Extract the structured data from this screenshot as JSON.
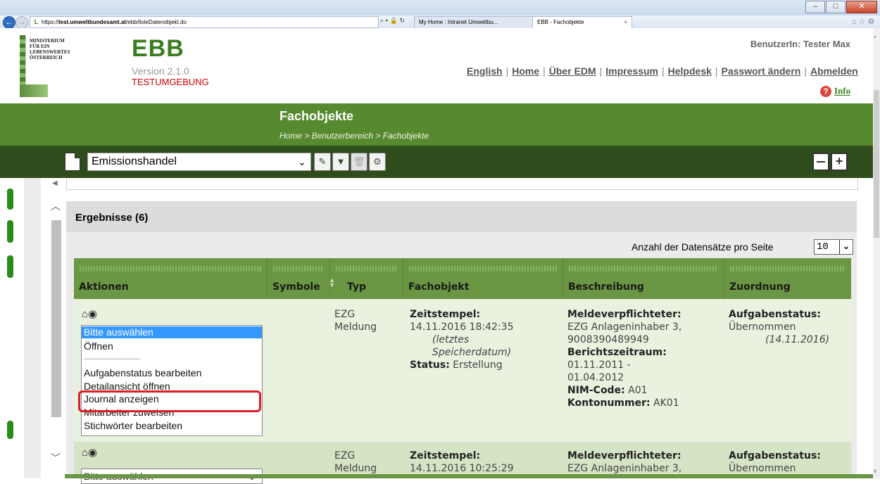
{
  "browser": {
    "address_host": "test.umweltbundesamt.at",
    "address_path": "/ebb/listeDatenobjekt.do",
    "tabs": [
      {
        "label": "My Home : Intranet Umweltbu..."
      },
      {
        "label": "EBB - Fachobjekte"
      }
    ]
  },
  "ministry": {
    "text": "MINISTERIUM\nFÜR EIN\nLEBENSWERTES\nÖSTERREICH"
  },
  "app": {
    "logo": "EBB",
    "version": "Version 2.1.0",
    "environment": "TESTUMGEBUNG"
  },
  "user": {
    "label": "BenutzerIn: Tester Max"
  },
  "top_links": {
    "english": "English",
    "home": "Home",
    "about": "Über EDM",
    "imprint": "Impressum",
    "helpdesk": "Helpdesk",
    "password": "Passwort ändern",
    "logout": "Abmelden"
  },
  "info": {
    "label": "Info"
  },
  "page": {
    "title": "Fachobjekte",
    "breadcrumb": "Home > Benutzerbereich > Fachobjekte"
  },
  "toolbar": {
    "category": "Emissionshandel"
  },
  "results": {
    "title": "Ergebnisse (6)",
    "per_page_label": "Anzahl der Datensätze pro Seite",
    "per_page_value": "10"
  },
  "table": {
    "headers": {
      "actions": "Aktionen",
      "symbols": "Symbole",
      "type": "Typ",
      "object": "Fachobjekt",
      "description": "Beschreibung",
      "assignment": "Zuordnung"
    },
    "rows": [
      {
        "type_line1": "EZG",
        "type_line2": "Meldung",
        "timestamp_label": "Zeitstempel:",
        "timestamp": "14.11.2016 18:42:35",
        "timestamp_note_1": "(letztes",
        "timestamp_note_2": "Speicherdatum)",
        "status_label": "Status:",
        "status": "Erstellung",
        "reporter_label": "Meldeverpflichteter:",
        "reporter_line1": "EZG Anlageninhaber 3,",
        "reporter_line2": "9008390489949",
        "period_label": "Berichtszeitraum:",
        "period_line1": "01.11.2011 -",
        "period_line2": "01.04.2012",
        "nim_label": "NIM-Code:",
        "nim": "A01",
        "account_label": "Kontonummer:",
        "account": "AK01",
        "task_label": "Aufgabenstatus:",
        "task": "Übernommen",
        "task_date": "(14.11.2016)"
      },
      {
        "type_line1": "EZG",
        "type_line2": "Meldung",
        "timestamp_label": "Zeitstempel:",
        "timestamp": "14.11.2016 10:25:29",
        "reporter_label": "Meldeverpflichteter:",
        "reporter_line1": "EZG Anlageninhaber 3,",
        "task_label": "Aufgabenstatus:",
        "task": "Übernommen"
      }
    ]
  },
  "action_menu": {
    "options": [
      "Bitte auswählen",
      "Öffnen",
      "----------------------------------",
      "Aufgabenstatus bearbeiten",
      "Detailansicht öffnen",
      "Journal anzeigen",
      "Mitarbeiter zuweisen",
      "Stichwörter bearbeiten"
    ],
    "selected_index": 0,
    "highlighted": "Journal anzeigen",
    "collapsed_value": "Bitte auswählen"
  },
  "icons": {
    "back": "back-arrow-icon",
    "forward": "forward-arrow-icon",
    "document": "document-icon",
    "edit": "edit-icon",
    "filter": "filter-icon",
    "delete": "trash-icon",
    "settings": "settings-icon",
    "collapse": "collapse-icon",
    "expand": "expand-icon",
    "info": "help-icon",
    "row_actions": "house-eye-icon"
  },
  "colors": {
    "brand_green": "#3a7d1e",
    "band_green": "#578a30",
    "toolbar_dark": "#2f4d1c",
    "table_head": "#6b9744",
    "highlight_red": "#e01b24",
    "env_red": "#cc0000"
  }
}
